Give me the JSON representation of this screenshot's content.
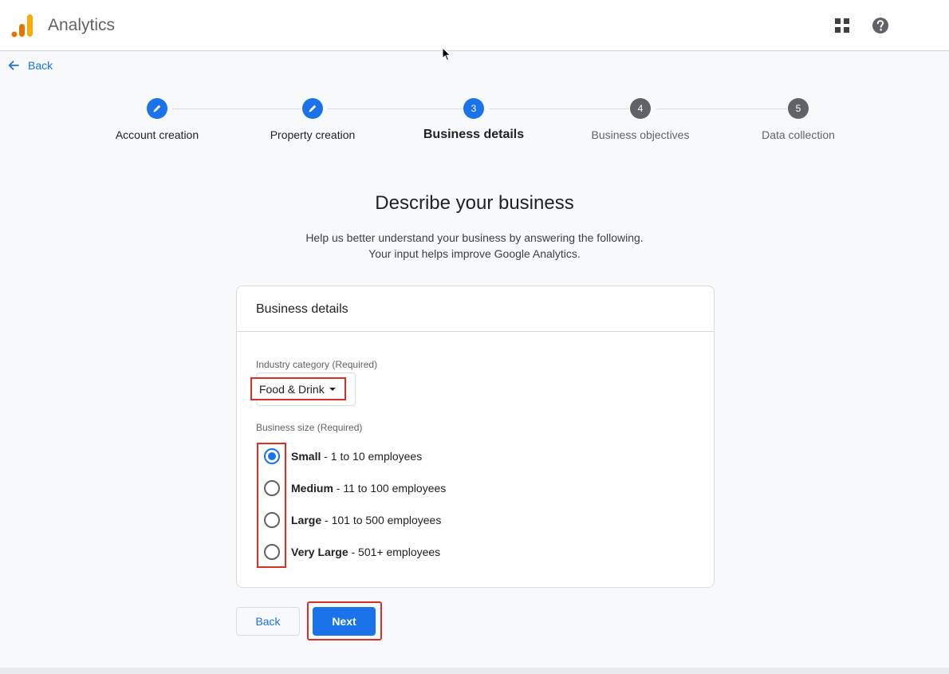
{
  "header": {
    "app_title": "Analytics",
    "logo_icon": "analytics-logo",
    "apps_icon": "apps-grid-icon",
    "help_icon": "help-icon"
  },
  "nav": {
    "back_label": "Back"
  },
  "stepper": {
    "steps": [
      {
        "label": "Account creation",
        "state": "done",
        "marker": "pencil"
      },
      {
        "label": "Property creation",
        "state": "done",
        "marker": "pencil"
      },
      {
        "label": "Business details",
        "state": "active",
        "marker": "3"
      },
      {
        "label": "Business objectives",
        "state": "pending",
        "marker": "4"
      },
      {
        "label": "Data collection",
        "state": "pending",
        "marker": "5"
      }
    ]
  },
  "page": {
    "title": "Describe your business",
    "subtitle_line1": "Help us better understand your business by answering the following.",
    "subtitle_line2": "Your input helps improve Google Analytics."
  },
  "card": {
    "title": "Business details",
    "industry_label": "Industry category (Required)",
    "industry_value": "Food & Drink",
    "size_label": "Business size (Required)",
    "size_options": [
      {
        "name": "Small",
        "desc": " - 1 to 10 employees",
        "checked": true
      },
      {
        "name": "Medium",
        "desc": " - 11 to 100 employees",
        "checked": false
      },
      {
        "name": "Large",
        "desc": " - 101 to 500 employees",
        "checked": false
      },
      {
        "name": "Very Large",
        "desc": " - 501+ employees",
        "checked": false
      }
    ]
  },
  "actions": {
    "back_label": "Back",
    "next_label": "Next"
  },
  "colors": {
    "primary": "#1a73e8",
    "highlight": "#d93025",
    "pending": "#5f6368"
  }
}
